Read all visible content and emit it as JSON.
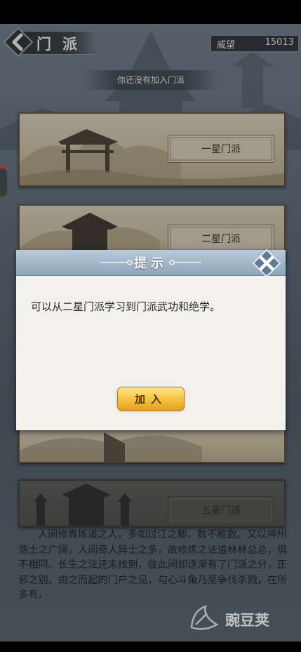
{
  "header": {
    "title": "门派",
    "reputation_label": "威望",
    "reputation_value": "15013"
  },
  "status": {
    "text": "你还没有加入门派"
  },
  "sects": [
    {
      "label": "一星门派"
    },
    {
      "label": "二星门派"
    },
    {
      "label": "五星门派"
    }
  ],
  "dialog": {
    "title": "提示",
    "message": "可以从二星门派学习到门派武功和绝学。",
    "join_label": "加入"
  },
  "lore": {
    "text": "人间修真炼道之人，多如过江之鲫，数不胜数。又以神州浩土之广阔，人间奇人异士之多，故修炼之法道林林总总，俱不相同。长生之法还未找到，彼此间却逐渐有了门派之分，正邪之别。由之而起的门户之见，勾心斗角乃至争伐杀戮，在所多有。"
  },
  "watermark": {
    "text": "豌豆荚"
  },
  "colors": {
    "dialog_header": "#8fa6ba",
    "join_button": "#f7c444",
    "card_paper": "#cbbd9f"
  }
}
